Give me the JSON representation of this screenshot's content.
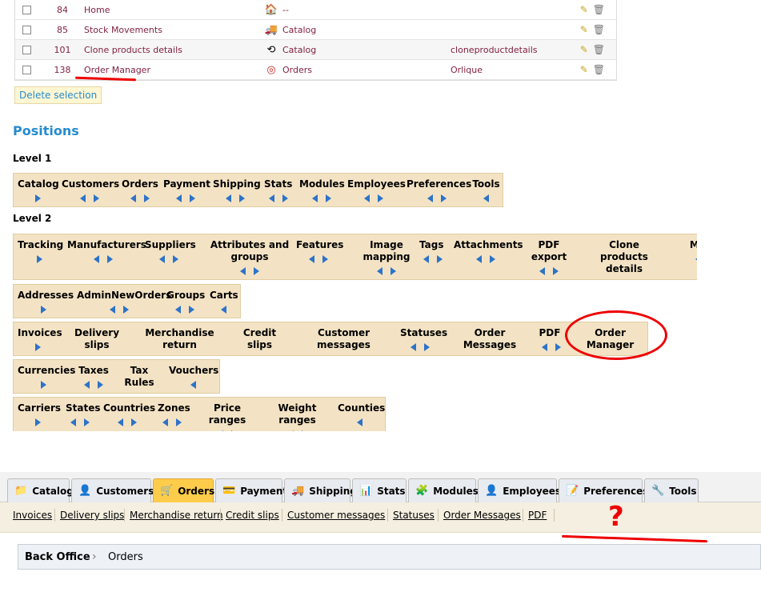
{
  "modules_table": {
    "rows": [
      {
        "id": "84",
        "name": "Home",
        "tab": "--",
        "class": "",
        "icon": "home-icon",
        "alt": false
      },
      {
        "id": "85",
        "name": "Stock Movements",
        "tab": "Catalog",
        "class": "",
        "icon": "truck-icon",
        "alt": false
      },
      {
        "id": "101",
        "name": "Clone products details",
        "tab": "Catalog",
        "class": "cloneproductdetails",
        "icon": "clone-icon",
        "alt": true
      },
      {
        "id": "138",
        "name": "Order Manager",
        "tab": "Orders",
        "class": "Orlique",
        "icon": "ring-icon",
        "alt": false
      }
    ],
    "delete_label": "Delete selection"
  },
  "positions": {
    "title": "Positions",
    "level1_label": "Level 1",
    "level2_label": "Level 2",
    "level1": [
      "Catalog",
      "Customers",
      "Orders",
      "Payment",
      "Shipping",
      "Stats",
      "Modules",
      "Employees",
      "Preferences",
      "Tools"
    ],
    "level2_rows": [
      [
        "Tracking",
        "Manufacturers",
        "Suppliers",
        "Attributes and groups",
        "Features",
        "Image mapping",
        "Tags",
        "Attachments",
        "PDF export",
        "Clone products details",
        "Mo"
      ],
      [
        "Addresses",
        "AdminNewOrders",
        "Groups",
        "Carts"
      ],
      [
        "Invoices",
        "Delivery slips",
        "Merchandise return",
        "Credit slips",
        "Customer messages",
        "Statuses",
        "Order Messages",
        "PDF",
        "Order Manager"
      ],
      [
        "Currencies",
        "Taxes",
        "Tax Rules",
        "Vouchers"
      ],
      [
        "Carriers",
        "States",
        "Countries",
        "Zones",
        "Price ranges",
        "Weight ranges",
        "Counties"
      ]
    ]
  },
  "annotation": {
    "question_mark": "?"
  },
  "admin_tabs": [
    {
      "label": "Catalog",
      "icon": "folder-icon"
    },
    {
      "label": "Customers",
      "icon": "user-icon"
    },
    {
      "label": "Orders",
      "icon": "cart-icon",
      "active": true
    },
    {
      "label": "Payment",
      "icon": "payment-icon"
    },
    {
      "label": "Shipping",
      "icon": "truck-icon"
    },
    {
      "label": "Stats",
      "icon": "chart-icon"
    },
    {
      "label": "Modules",
      "icon": "puzzle-icon"
    },
    {
      "label": "Employees",
      "icon": "user-icon"
    },
    {
      "label": "Preferences",
      "icon": "preferences-icon"
    },
    {
      "label": "Tools",
      "icon": "wrench-icon"
    }
  ],
  "subtabs": [
    "Invoices",
    "Delivery slips",
    "Merchandise return",
    "Credit slips",
    "Customer messages",
    "Statuses",
    "Order Messages",
    "PDF"
  ],
  "breadcrumb": {
    "root": "Back Office",
    "current": "Orders"
  }
}
